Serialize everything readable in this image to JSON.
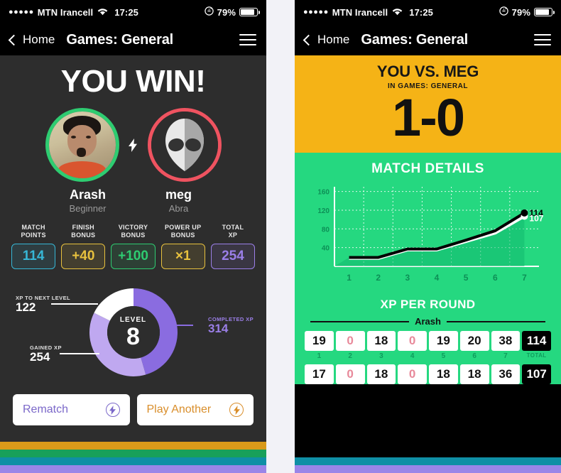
{
  "status_bar": {
    "signal_dots": "●●●●●",
    "carrier": "MTN Irancell",
    "wifi_icon": "wifi-icon",
    "time": "17:25",
    "lock_icon": "rotation-lock-icon",
    "battery_percent": "79%"
  },
  "nav": {
    "back_label": "Home",
    "title": "Games: General",
    "menu_icon": "hamburger-menu-icon"
  },
  "left_screen": {
    "headline": "YOU WIN!",
    "players": [
      {
        "name": "Arash",
        "rank": "Beginner",
        "ring_color": "#2ecc71",
        "avatar": "photo-avatar"
      },
      {
        "name": "meg",
        "rank": "Abra",
        "ring_color": "#ef5360",
        "avatar": "alien-avatar"
      }
    ],
    "versus_icon": "lightning-bolt-icon",
    "stats": [
      {
        "label": "MATCH\nPOINTS",
        "value": "114",
        "color": "#37b7d6"
      },
      {
        "label": "FINISH\nBONUS",
        "value": "+40",
        "color": "#e8c13e"
      },
      {
        "label": "VICTORY\nBONUS",
        "value": "+100",
        "color": "#2ecc71"
      },
      {
        "label": "POWER UP\nBONUS",
        "value": "×1",
        "color": "#e8c13e"
      },
      {
        "label": "TOTAL\nXP",
        "value": "254",
        "color": "#9b7fe8"
      }
    ],
    "donut": {
      "level_word": "LEVEL",
      "level_value": "8",
      "segments": [
        {
          "label": "COMPLETED XP",
          "value": "314",
          "color": "#8a6ce0"
        },
        {
          "label": "GAINED XP",
          "value": "254",
          "color": "#bfa8f0"
        },
        {
          "label": "XP TO NEXT LEVEL",
          "value": "122",
          "color": "#ffffff"
        }
      ]
    },
    "buttons": [
      {
        "label": "Rematch",
        "icon": "lightning-bolt-icon",
        "color": "#7b68c9"
      },
      {
        "label": "Play Another",
        "icon": "lightning-bolt-icon",
        "color": "#d98e2b"
      }
    ],
    "stripes": [
      "#d99a1a",
      "#18a05a",
      "#0f8fa5",
      "#9a85e8"
    ]
  },
  "right_screen": {
    "hero": {
      "title": "YOU VS. MEG",
      "subtitle": "IN GAMES: GENERAL",
      "score": "1-0",
      "bg_color": "#f5b316"
    },
    "match_details_title": "MATCH DETAILS",
    "xp_per_round_title": "XP PER ROUND",
    "player_name": "Arash",
    "round_labels": [
      "1",
      "2",
      "3",
      "4",
      "5",
      "6",
      "7"
    ],
    "total_label": "TOTAL",
    "rows": [
      {
        "values": [
          "19",
          "0",
          "18",
          "0",
          "19",
          "20",
          "38"
        ],
        "total": "114"
      },
      {
        "values": [
          "17",
          "0",
          "18",
          "0",
          "18",
          "18",
          "36"
        ],
        "total": "107"
      }
    ],
    "stripes": [
      "#0f8fa5",
      "#9a85e8"
    ]
  },
  "chart_data": {
    "type": "line",
    "title": "MATCH DETAILS",
    "xlabel": "",
    "ylabel": "",
    "x": [
      1,
      2,
      3,
      4,
      5,
      6,
      7
    ],
    "xticklabels": [
      "1",
      "2",
      "3",
      "4",
      "5",
      "6",
      "7"
    ],
    "yticks": [
      40,
      80,
      120,
      160
    ],
    "ylim": [
      0,
      170
    ],
    "grid": true,
    "legend": "none",
    "series": [
      {
        "name": "Arash",
        "color": "#000000",
        "values": [
          19,
          19,
          37,
          37,
          56,
          76,
          114
        ],
        "end_label": "114"
      },
      {
        "name": "meg",
        "color": "#ffffff",
        "values": [
          17,
          17,
          35,
          35,
          53,
          71,
          107
        ],
        "end_label": "107"
      }
    ],
    "annotations": [
      {
        "text": "114",
        "color": "#000000"
      },
      {
        "text": "107",
        "color": "#ffffff"
      }
    ]
  }
}
